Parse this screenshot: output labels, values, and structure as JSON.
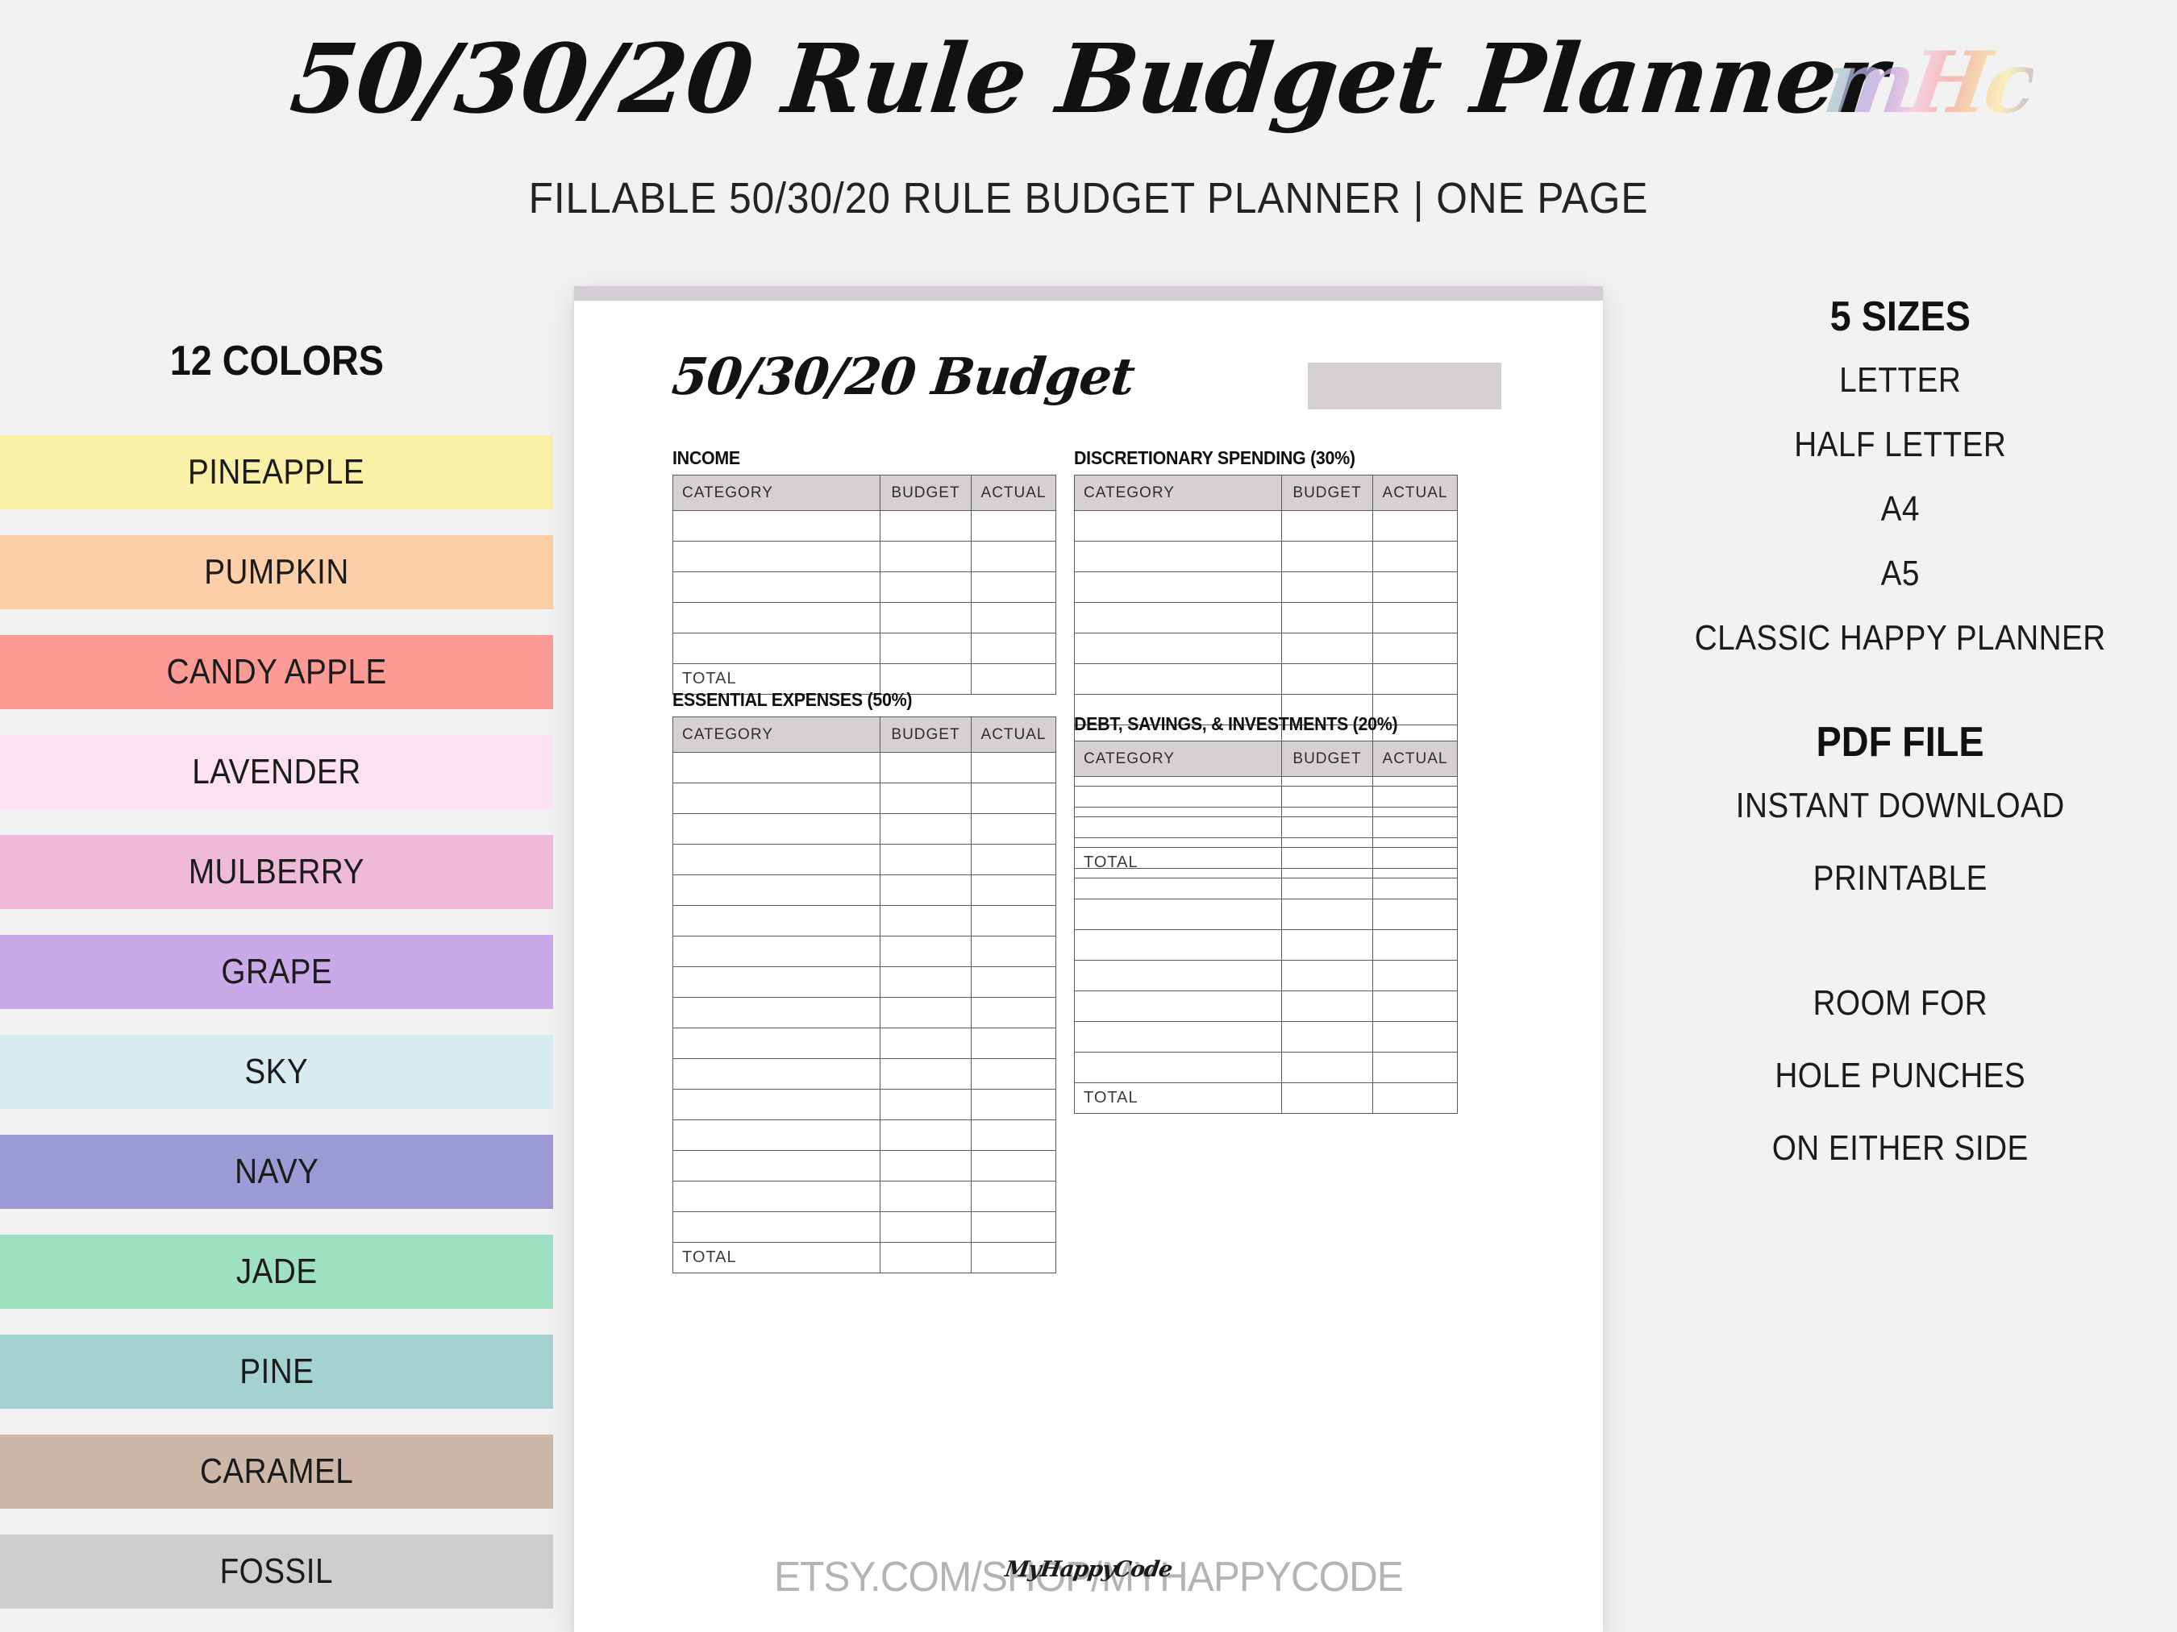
{
  "header": {
    "title": "50/30/20 Rule Budget Planner",
    "subtitle": "FILLABLE 50/30/20 RULE BUDGET PLANNER | ONE PAGE",
    "brand_logo": "mHc"
  },
  "left_panel": {
    "heading": "12 COLORS",
    "swatches": [
      {
        "label": "PINEAPPLE",
        "color": "#faf0a8"
      },
      {
        "label": "PUMPKIN",
        "color": "#fdcfa8"
      },
      {
        "label": "CANDY APPLE",
        "color": "#fc9a96"
      },
      {
        "label": "LAVENDER",
        "color": "#fde2ef"
      },
      {
        "label": "MULBERRY",
        "color": "#eebad8"
      },
      {
        "label": "GRAPE",
        "color": "#c9a9e8"
      },
      {
        "label": "SKY",
        "color": "#d8ecf2"
      },
      {
        "label": "NAVY",
        "color": "#9b9ad4"
      },
      {
        "label": "JADE",
        "color": "#9fe0c3"
      },
      {
        "label": "PINE",
        "color": "#a4d2d0"
      },
      {
        "label": "CARAMEL",
        "color": "#cdb7a9"
      },
      {
        "label": "FOSSIL",
        "color": "#cfcdcd"
      }
    ]
  },
  "planner": {
    "title": "50/30/20 Budget",
    "date_box": "",
    "header_band_color": "#d4ced4",
    "table_header_color": "#d5d0d4",
    "columns": [
      "CATEGORY",
      "BUDGET",
      "ACTUAL"
    ],
    "total_label": "TOTAL",
    "sections": [
      {
        "name": "income",
        "title": "INCOME",
        "rows": 5
      },
      {
        "name": "essential",
        "title": "ESSENTIAL EXPENSES (50%)",
        "rows": 16
      },
      {
        "name": "discretionary",
        "title": "DISCRETIONARY SPENDING (30%)",
        "rows": 11
      },
      {
        "name": "debt",
        "title": "DEBT, SAVINGS, & INVESTMENTS (20%)",
        "rows": 10
      }
    ],
    "footer_url": "ETSY.COM/SHOP/MYHAPPYCODE",
    "footer_script": "MyHappyCode"
  },
  "right_panel": {
    "sizes": {
      "heading": "5 SIZES",
      "items": [
        "LETTER",
        "HALF LETTER",
        "A4",
        "A5",
        "CLASSIC HAPPY PLANNER"
      ]
    },
    "file": {
      "heading": "PDF FILE",
      "items": [
        "INSTANT DOWNLOAD",
        "PRINTABLE"
      ]
    },
    "room": {
      "items": [
        "ROOM FOR",
        "HOLE PUNCHES",
        "ON EITHER SIDE"
      ]
    }
  }
}
